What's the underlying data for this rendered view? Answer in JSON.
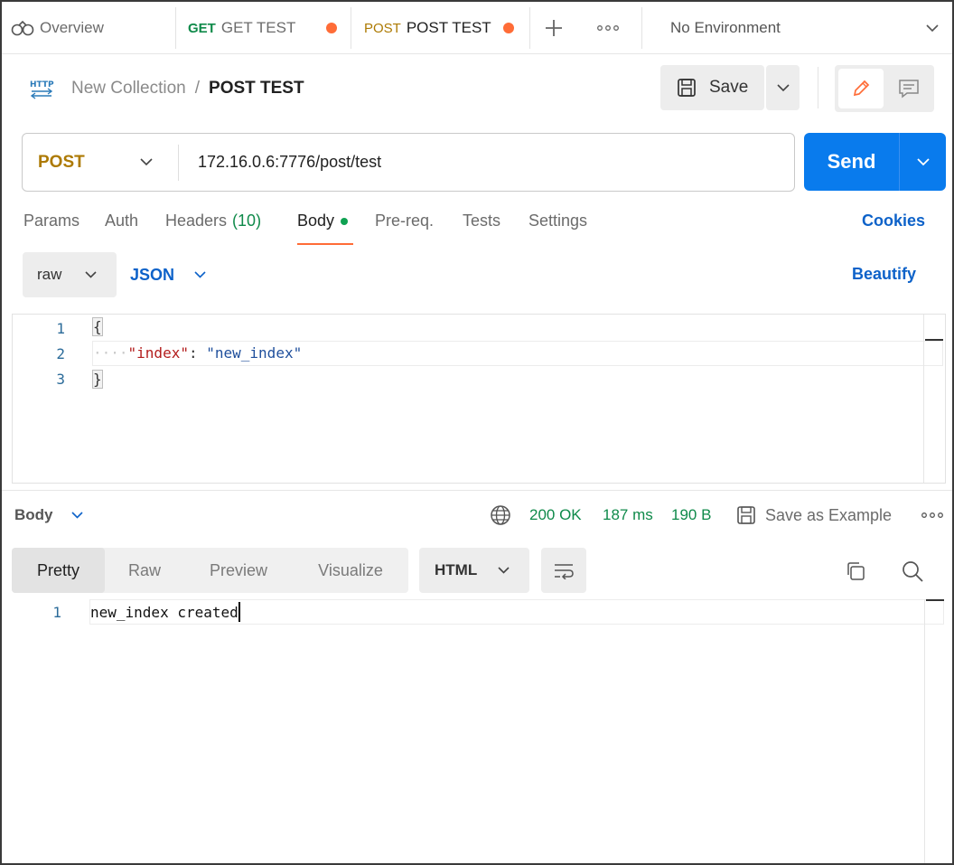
{
  "tabs": {
    "overview_label": "Overview",
    "items": [
      {
        "method": "GET",
        "name": "GET TEST",
        "unsaved": true
      },
      {
        "method": "POST",
        "name": "POST TEST",
        "unsaved": true
      }
    ],
    "environment": "No Environment"
  },
  "header": {
    "collection": "New Collection",
    "separator": "/",
    "request_name": "POST TEST",
    "save_label": "Save"
  },
  "request": {
    "method": "POST",
    "url": "172.16.0.6:7776/post/test",
    "send_label": "Send"
  },
  "request_tabs": {
    "params": "Params",
    "auth": "Auth",
    "headers": "Headers",
    "headers_count": "(10)",
    "body": "Body",
    "prereq": "Pre-req.",
    "tests": "Tests",
    "settings": "Settings",
    "cookies": "Cookies"
  },
  "body_options": {
    "mode": "raw",
    "language": "JSON",
    "beautify": "Beautify"
  },
  "editor": {
    "line_numbers": [
      "1",
      "2",
      "3"
    ],
    "open_brace": "{",
    "indent_dots": "····",
    "key": "\"index\"",
    "colon": ":",
    "value": "\"new_index\"",
    "close_brace": "}"
  },
  "response": {
    "section_label": "Body",
    "status": "200 OK",
    "time": "187 ms",
    "size": "190 B",
    "save_example": "Save as Example",
    "views": [
      "Pretty",
      "Raw",
      "Preview",
      "Visualize"
    ],
    "active_view": "Pretty",
    "format": "HTML",
    "line_number": "1",
    "content": "new_index created"
  },
  "colors": {
    "accent_orange": "#ff6c37",
    "send_blue": "#097bed",
    "status_green": "#0f8a4a",
    "post_method": "#ad7a03",
    "link_blue": "#0d62c9"
  }
}
